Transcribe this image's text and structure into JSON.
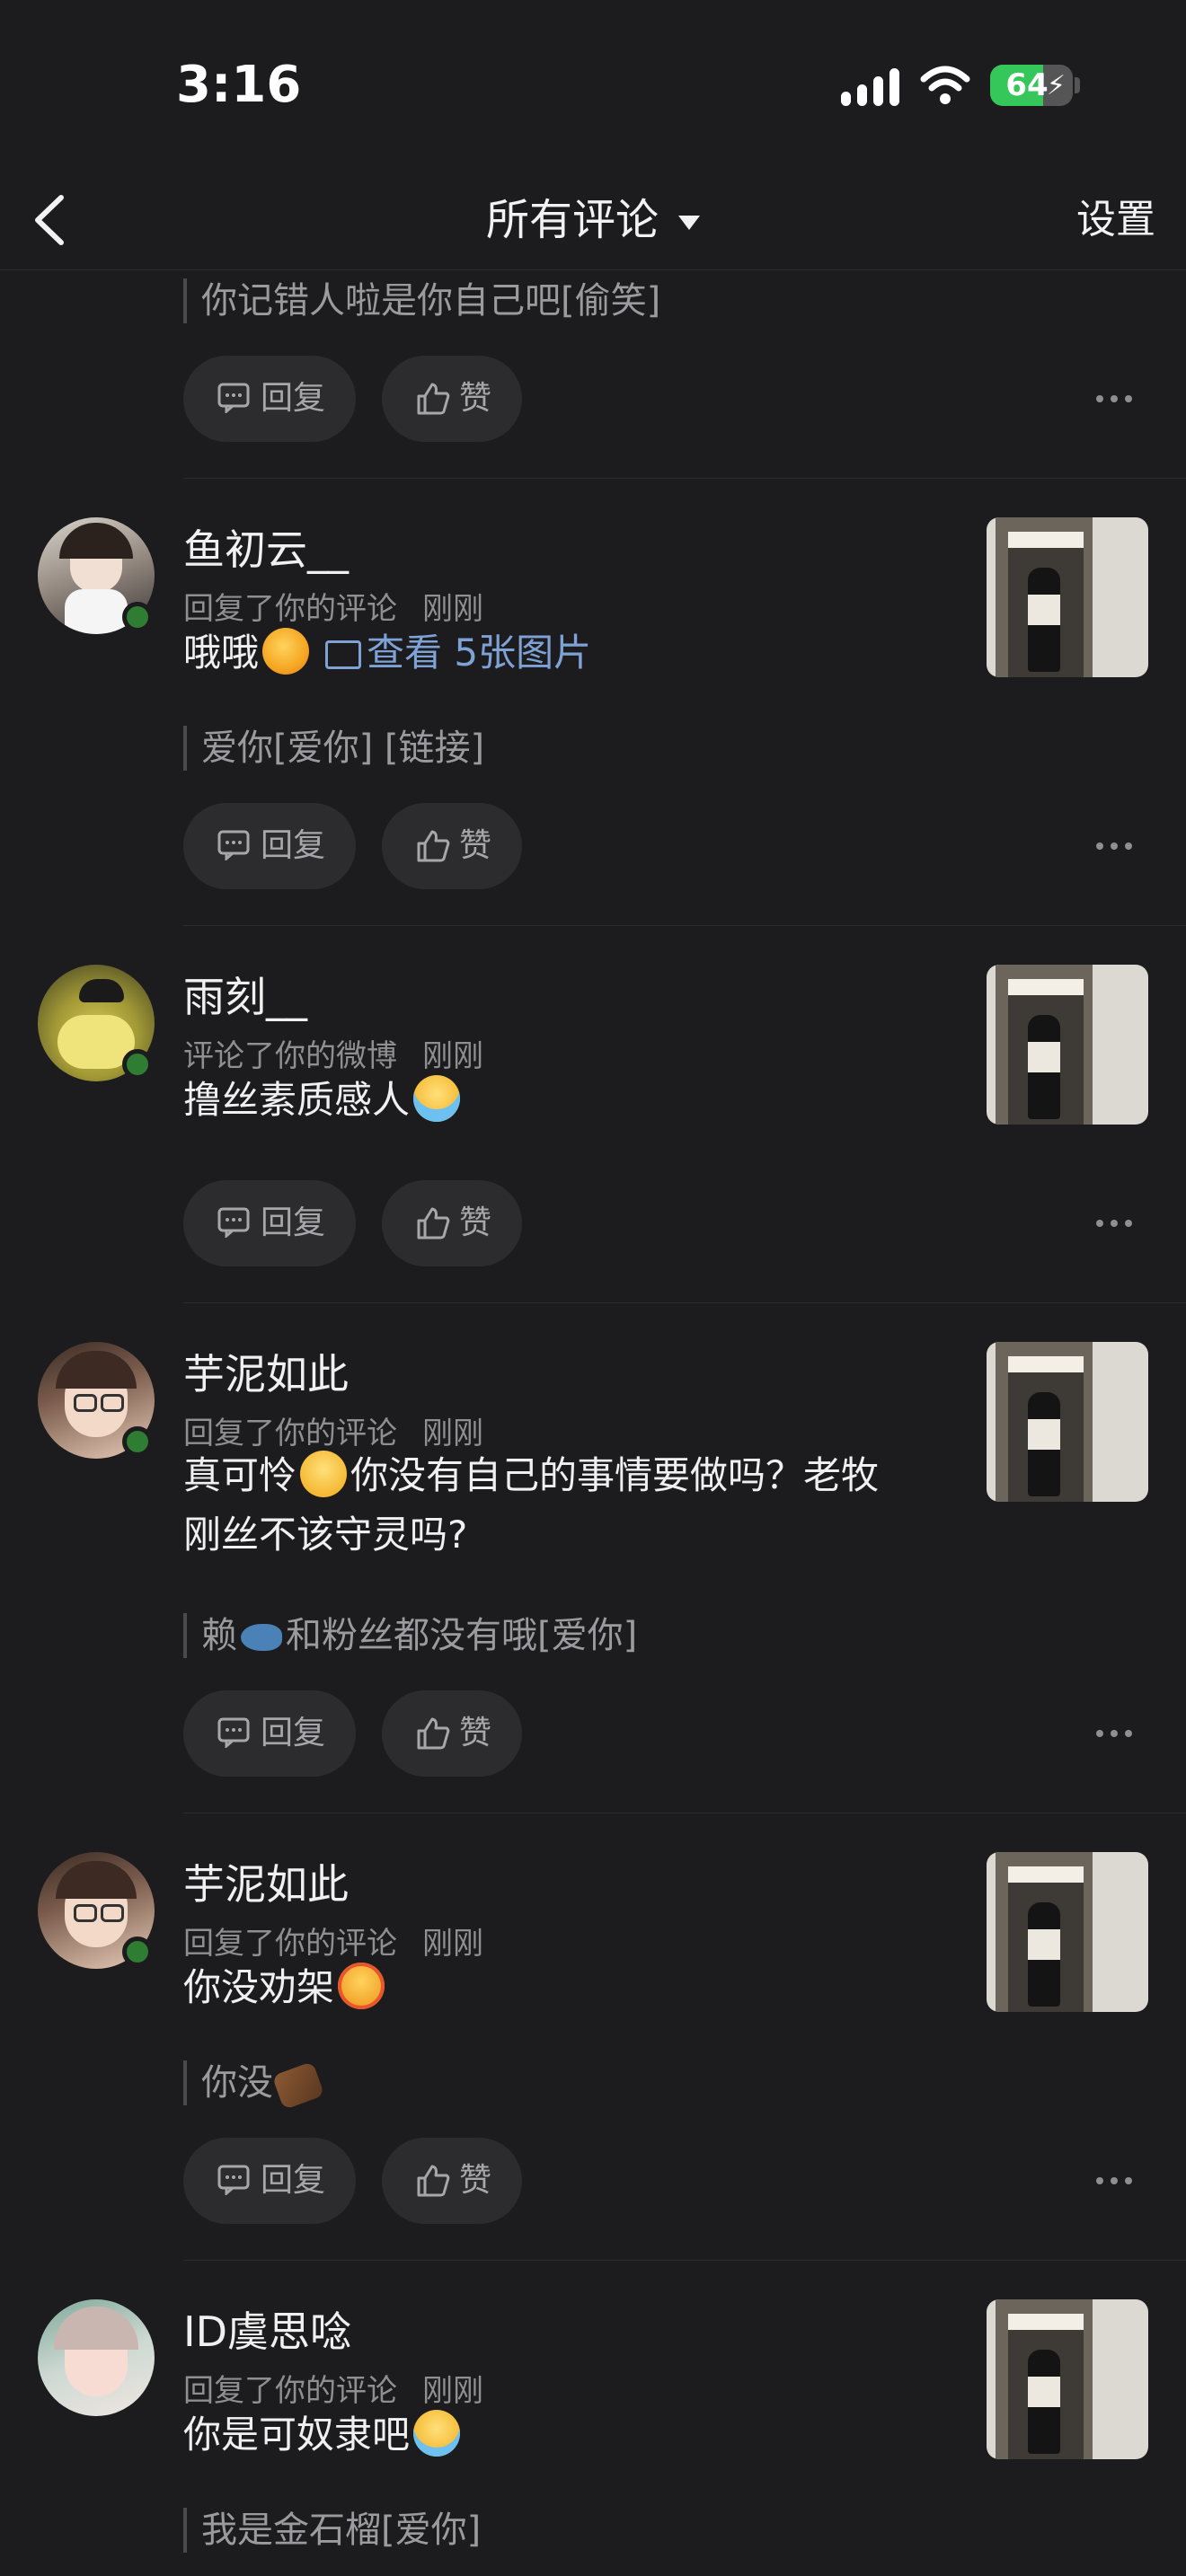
{
  "status": {
    "time": "3:16",
    "battery": "64",
    "battery_level": 0.64
  },
  "nav": {
    "title": "所有评论",
    "settings": "设置"
  },
  "actions": {
    "reply": "回复",
    "like": "赞"
  },
  "top_partial": {
    "quote": "你记错人啦是你自己吧[偷笑]"
  },
  "comments": [
    {
      "name": "鱼初云__",
      "action": "回复了你的评论",
      "time": "刚刚",
      "text": "哦哦",
      "link": "查看 5张图片",
      "quote": "爱你[爱你] [链接]"
    },
    {
      "name": "雨刻__",
      "action": "评论了你的微博",
      "time": "刚刚",
      "text": "撸丝素质感人"
    },
    {
      "name": "芋泥如此",
      "action": "回复了你的评论",
      "time": "刚刚",
      "text_a": "真可怜",
      "text_b": "你没有自己的事情要做吗？老牧",
      "text_c": "刚丝不该守灵吗?",
      "quote_a": "赖",
      "quote_b": "和粉丝都没有哦[爱你]"
    },
    {
      "name": "芋泥如此",
      "action": "回复了你的评论",
      "time": "刚刚",
      "text": "你没劝架",
      "quote": "你没"
    },
    {
      "name": "ID虞思唸",
      "action": "回复了你的评论",
      "time": "刚刚",
      "text": "你是可奴隶吧",
      "quote": "我是金石榴[爱你]"
    }
  ]
}
